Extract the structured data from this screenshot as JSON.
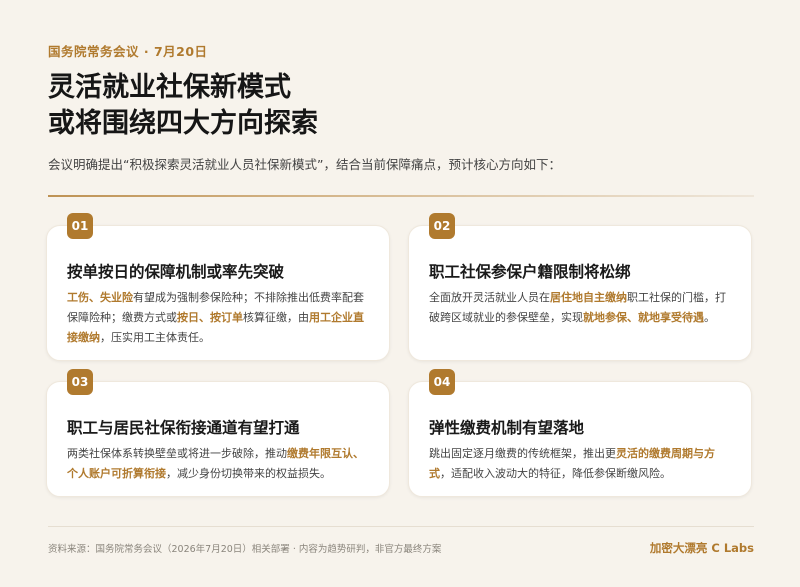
{
  "header": {
    "kicker": "国务院常务会议 · 7月20日",
    "title_line1": "灵活就业社保新模式",
    "title_line2": "或将围绕四大方向探索",
    "intro": "会议明确提出“积极探索灵活就业人员社保新模式”，结合当前保障痛点，预计核心方向如下："
  },
  "accent_color": "#b07a2e",
  "cards": [
    {
      "num": "01",
      "title": "按单按日的保障机制或率先突破",
      "body": [
        {
          "t": "工伤、失业险",
          "hl": true
        },
        {
          "t": "有望成为强制参保险种；不排除推出低费率配套保障险种；缴费方式或",
          "hl": false
        },
        {
          "t": "按日、按订单",
          "hl": true
        },
        {
          "t": "核算征缴，由",
          "hl": false
        },
        {
          "t": "用工企业直接缴纳",
          "hl": true
        },
        {
          "t": "，压实用工主体责任。",
          "hl": false
        }
      ]
    },
    {
      "num": "02",
      "title": "职工社保参保户籍限制将松绑",
      "body": [
        {
          "t": "全面放开灵活就业人员在",
          "hl": false
        },
        {
          "t": "居住地自主缴纳",
          "hl": true
        },
        {
          "t": "职工社保的门槛，打破跨区域就业的参保壁垒，实现",
          "hl": false
        },
        {
          "t": "就地参保、就地享受待遇",
          "hl": true
        },
        {
          "t": "。",
          "hl": false
        }
      ]
    },
    {
      "num": "03",
      "title": "职工与居民社保衔接通道有望打通",
      "body": [
        {
          "t": "两类社保体系转换壁垒或将进一步破除，推动",
          "hl": false
        },
        {
          "t": "缴费年限互认、个人账户可折算衔接",
          "hl": true
        },
        {
          "t": "，减少身份切换带来的权益损失。",
          "hl": false
        }
      ]
    },
    {
      "num": "04",
      "title": "弹性缴费机制有望落地",
      "body": [
        {
          "t": "跳出固定逐月缴费的传统框架，推出更",
          "hl": false
        },
        {
          "t": "灵活的缴费周期与方式",
          "hl": true
        },
        {
          "t": "，适配收入波动大的特征，降低参保断缴风险。",
          "hl": false
        }
      ]
    }
  ],
  "footer": {
    "source": "资料来源：国务院常务会议（2026年7月20日）相关部署 · 内容为趋势研判，非官方最终方案",
    "brand": "加密大漂亮 C Labs"
  }
}
